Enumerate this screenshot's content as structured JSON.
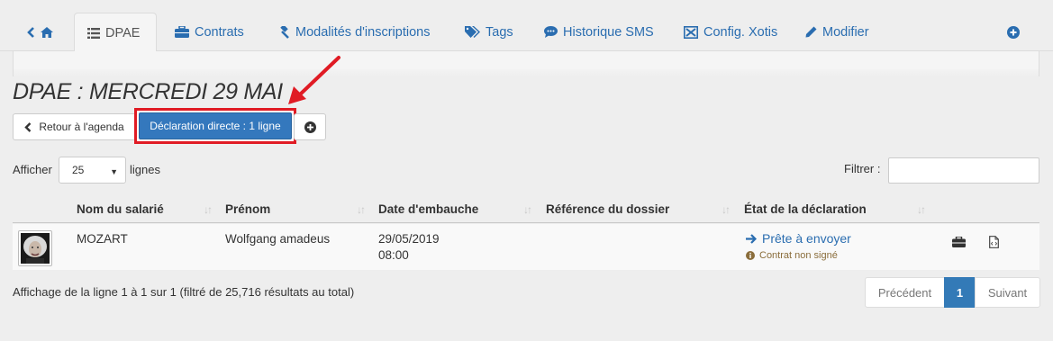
{
  "tabs": [
    {
      "label": "",
      "icon": "home-icon"
    },
    {
      "label": "DPAE",
      "icon": "list-icon"
    },
    {
      "label": "Contrats",
      "icon": "briefcase-icon"
    },
    {
      "label": "Modalités d'inscriptions",
      "icon": "gavel-icon"
    },
    {
      "label": "Tags",
      "icon": "tags-icon"
    },
    {
      "label": "Historique SMS",
      "icon": "comment-icon"
    },
    {
      "label": "Config. Xotis",
      "icon": "xotis-icon"
    },
    {
      "label": "Modifier",
      "icon": "pencil-icon"
    },
    {
      "label": "",
      "icon": "plus-circle-icon"
    }
  ],
  "page": {
    "title": "DPAE : MERCREDI 29 MAI"
  },
  "actions": {
    "back_label": "Retour à l'agenda",
    "direct_declaration_label": "Déclaration directe : 1 ligne",
    "highlight_color": "#e01b24"
  },
  "length": {
    "prefix": "Afficher",
    "value": "25",
    "suffix": "lignes"
  },
  "filter": {
    "label": "Filtrer :",
    "value": ""
  },
  "table": {
    "columns": [
      "Nom du salarié",
      "Prénom",
      "Date d'embauche",
      "Référence du dossier",
      "État de la déclaration"
    ],
    "rows": [
      {
        "nom": "MOZART",
        "prenom": "Wolfgang amadeus",
        "date": "29/05/2019",
        "heure": "08:00",
        "reference": "",
        "etat": "Prête à envoyer",
        "etat_note": "Contrat non signé"
      }
    ]
  },
  "footer": {
    "info": "Affichage de la ligne 1 à 1 sur 1 (filtré de 25,716 résultats au total)",
    "prev": "Précédent",
    "current": "1",
    "next": "Suivant"
  },
  "colors": {
    "primary": "#3478bd",
    "link": "#2a6db0",
    "warning": "#8a6d3b"
  }
}
